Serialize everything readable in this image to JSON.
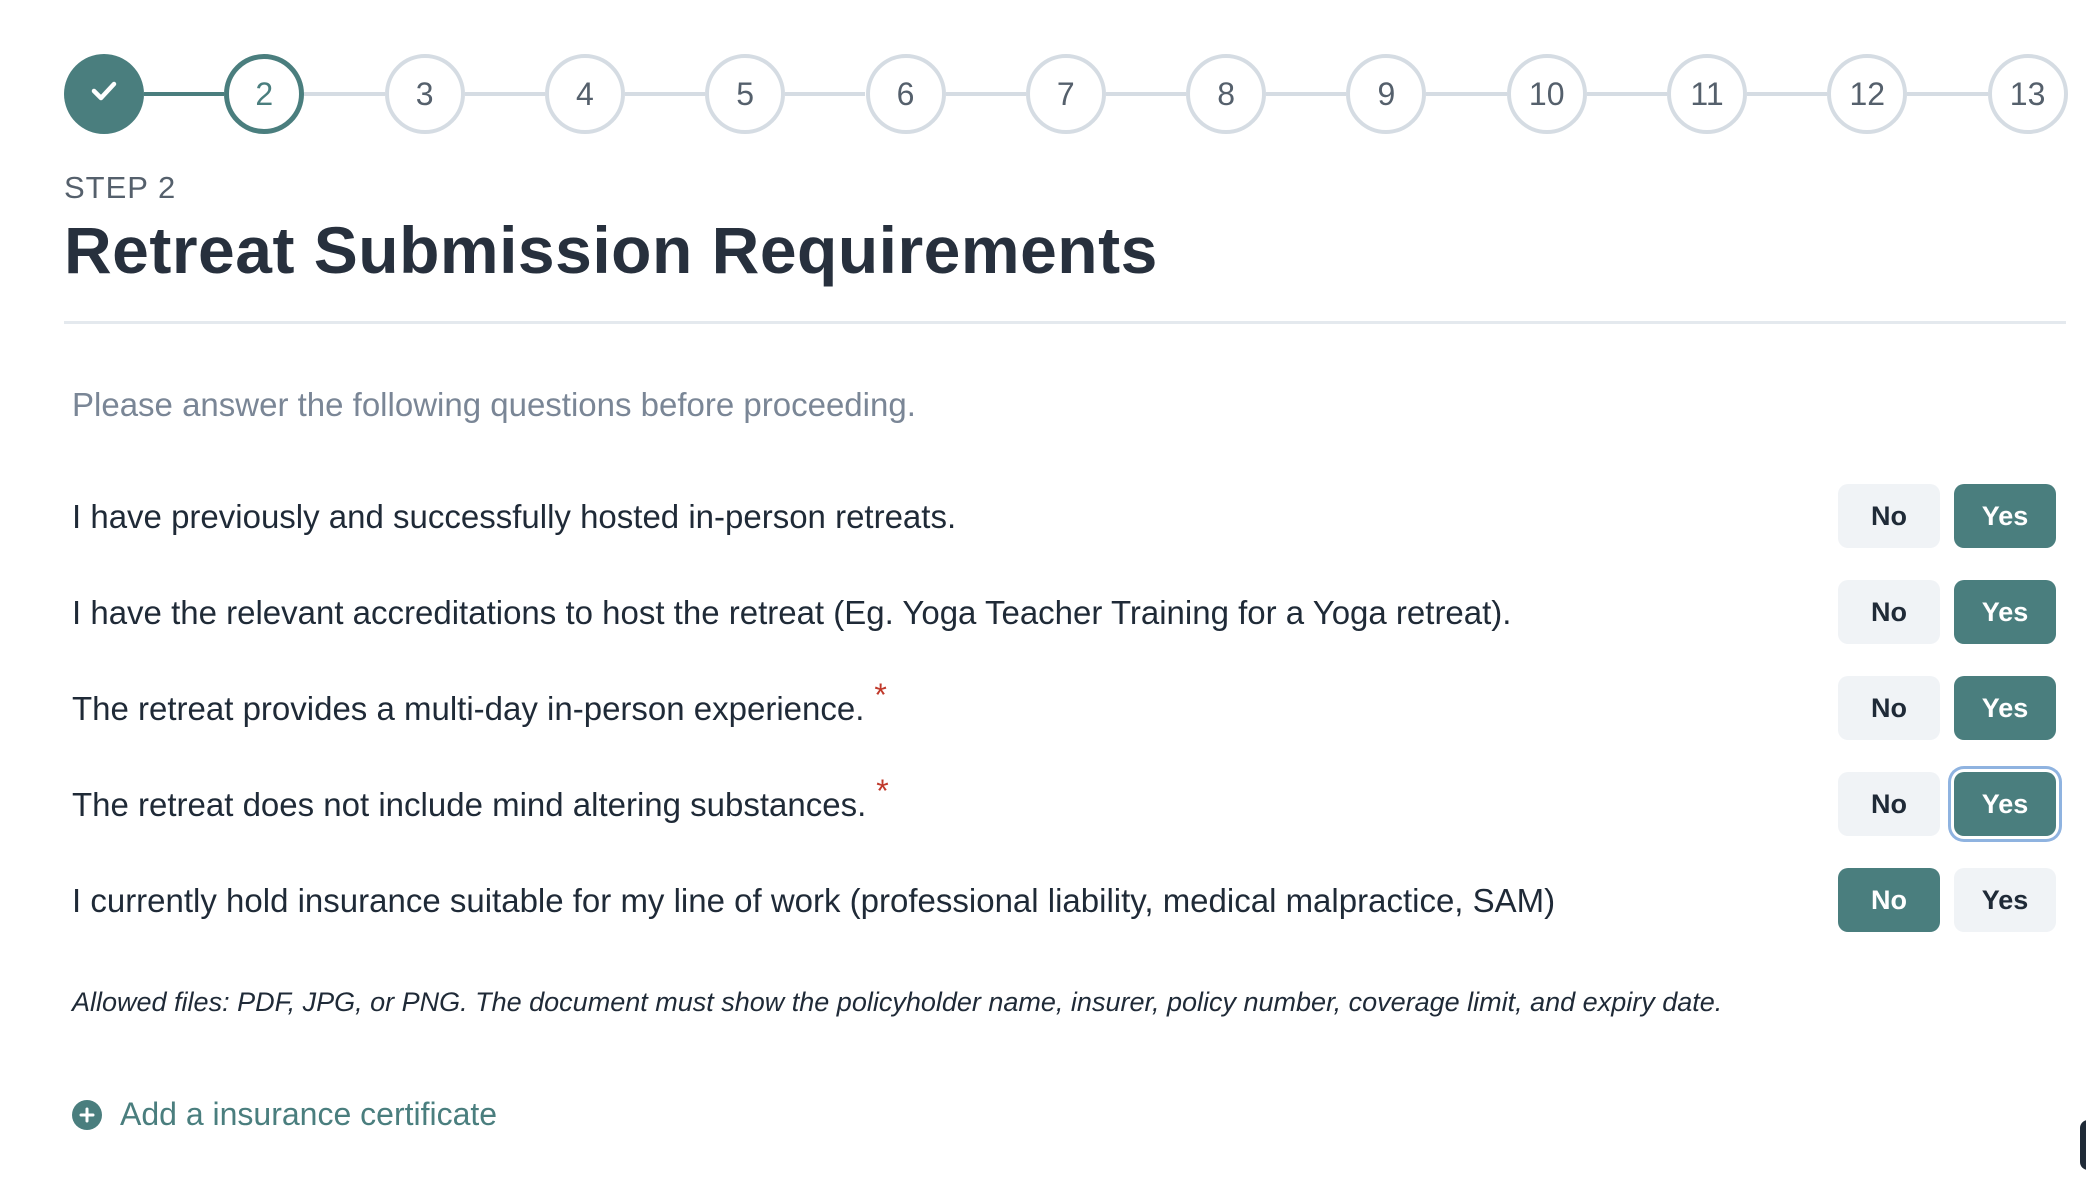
{
  "stepper": {
    "steps": [
      {
        "label": "",
        "state": "done"
      },
      {
        "label": "2",
        "state": "current"
      },
      {
        "label": "3",
        "state": "pending"
      },
      {
        "label": "4",
        "state": "pending"
      },
      {
        "label": "5",
        "state": "pending"
      },
      {
        "label": "6",
        "state": "pending"
      },
      {
        "label": "7",
        "state": "pending"
      },
      {
        "label": "8",
        "state": "pending"
      },
      {
        "label": "9",
        "state": "pending"
      },
      {
        "label": "10",
        "state": "pending"
      },
      {
        "label": "11",
        "state": "pending"
      },
      {
        "label": "12",
        "state": "pending"
      },
      {
        "label": "13",
        "state": "pending"
      }
    ],
    "done_icon": "check-icon"
  },
  "header": {
    "step_label": "STEP 2",
    "title": "Retreat Submission Requirements"
  },
  "intro": "Please answer the following questions before proceeding.",
  "questions": [
    {
      "text": "I have previously and successfully hosted in-person retreats.",
      "required": false,
      "answer": "Yes",
      "no_label": "No",
      "yes_label": "Yes"
    },
    {
      "text": "I have the relevant accreditations to host the retreat (Eg. Yoga Teacher Training for a Yoga retreat).",
      "required": false,
      "answer": "Yes",
      "no_label": "No",
      "yes_label": "Yes"
    },
    {
      "text": "The retreat provides a multi-day in-person experience.",
      "required": true,
      "answer": "Yes",
      "no_label": "No",
      "yes_label": "Yes"
    },
    {
      "text": "The retreat does not include mind altering substances.",
      "required": true,
      "answer": "Yes",
      "focused": true,
      "no_label": "No",
      "yes_label": "Yes"
    },
    {
      "text": "I currently hold insurance suitable for my line of work (professional liability, medical malpractice, SAM)",
      "required": false,
      "answer": "No",
      "no_label": "No",
      "yes_label": "Yes"
    }
  ],
  "required_marker": "*",
  "allowed_files_note": "Allowed files: PDF, JPG, or PNG. The document must show the policyholder name, insurer, policy number, coverage limit, and expiry date.",
  "add_certificate": {
    "label": "Add a insurance certificate",
    "icon": "plus-circle-icon"
  },
  "colors": {
    "accent": "#4a7e7e",
    "inactive_border": "#d5dce3",
    "required": "#c0392b"
  }
}
